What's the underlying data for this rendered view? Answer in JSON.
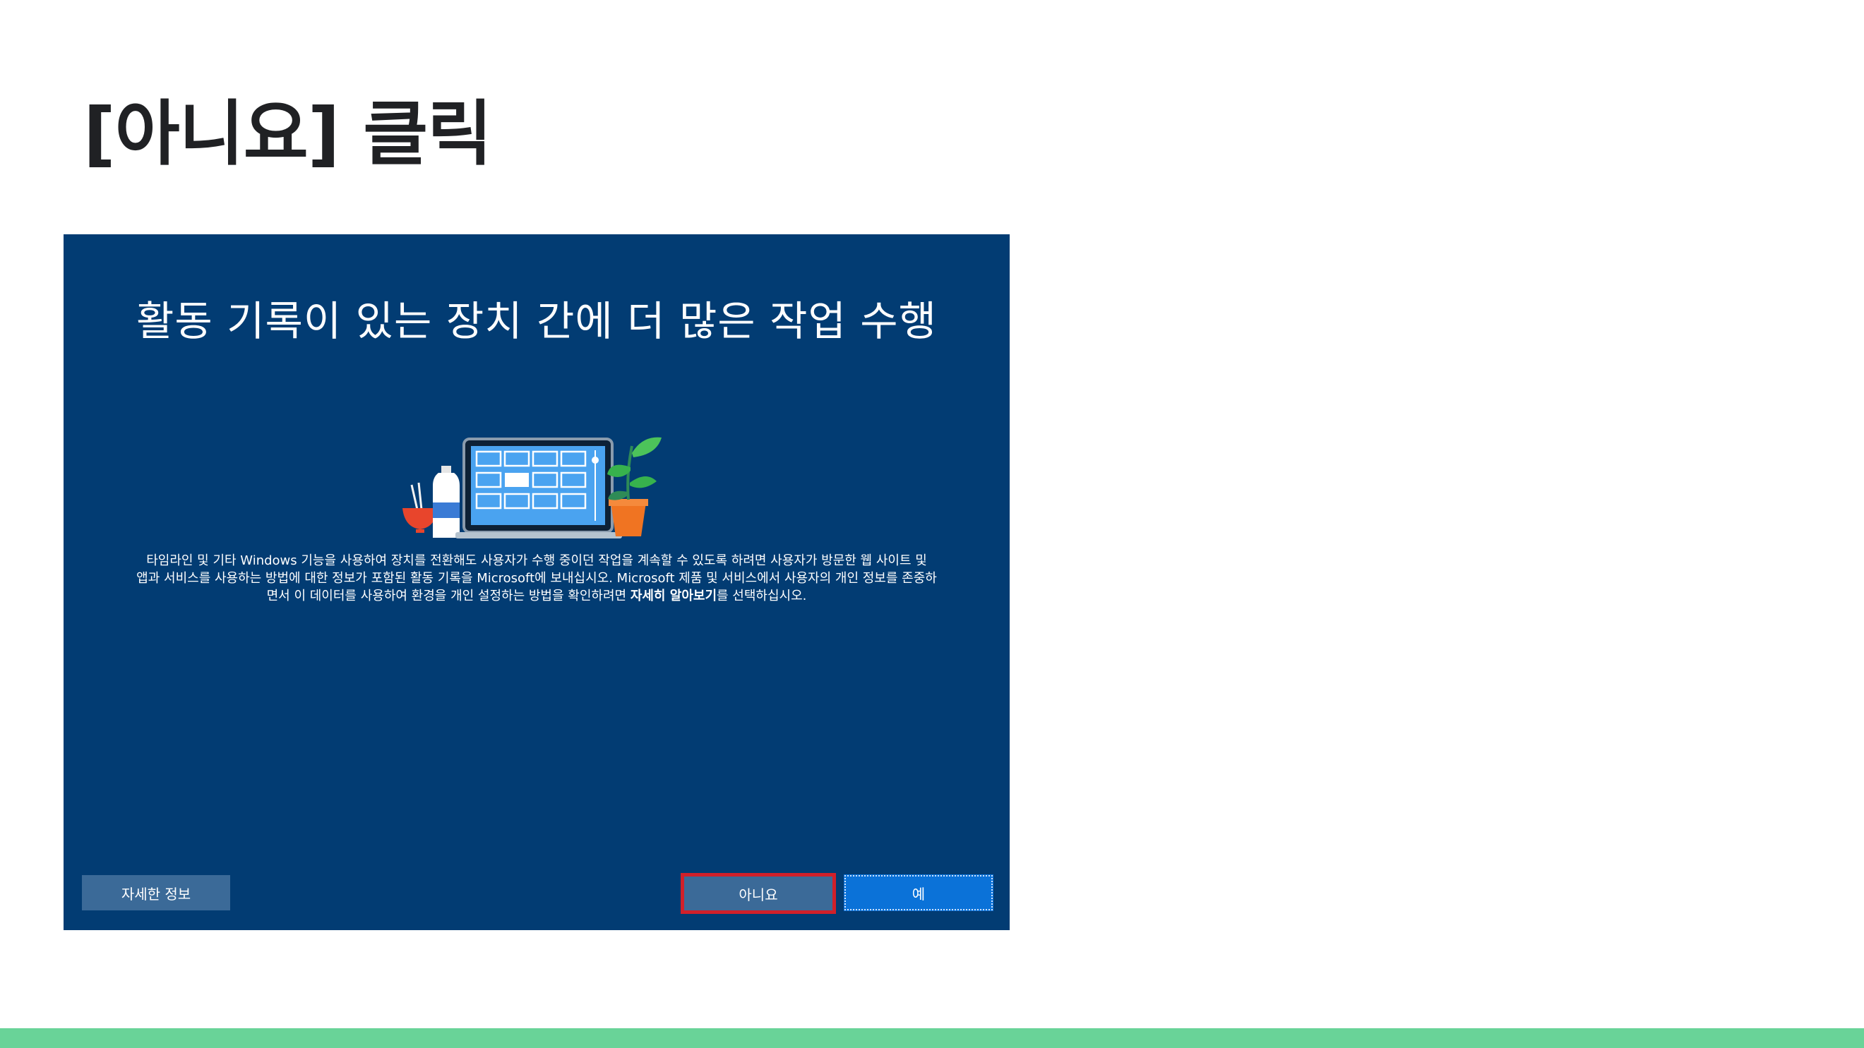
{
  "slide": {
    "title": "[아니요] 클릭",
    "accent_color": "#69d398"
  },
  "oobe": {
    "background_color": "#023c73",
    "heading": "활동 기록이 있는 장치 간에 더 많은 작업 수행",
    "illustration_icon": "laptop-timeline-illustration",
    "body_line1": "타임라인 및 기타 Windows 기능을 사용하여 장치를 전환해도 사용자가 수행 중이던 작업을 계속할 수 있도록 하려면 사용자가 방문한 웹 사이트 및",
    "body_line2": "앱과 서비스를 사용하는 방법에 대한 정보가 포함된 활동 기록을 Microsoft에 보내십시오. Microsoft 제품 및 서비스에서 사용자의 개인 정보를 존중하",
    "body_line3_pre": "면서 이 데이터를 사용하여 환경을 개인 설정하는 방법을 확인하려면 ",
    "body_line3_bold": "자세히 알아보기",
    "body_line3_post": "를 선택하십시오.",
    "buttons": {
      "learn_more": "자세한 정보",
      "no": "아니요",
      "yes": "예"
    },
    "highlight_color": "#d1202a"
  }
}
